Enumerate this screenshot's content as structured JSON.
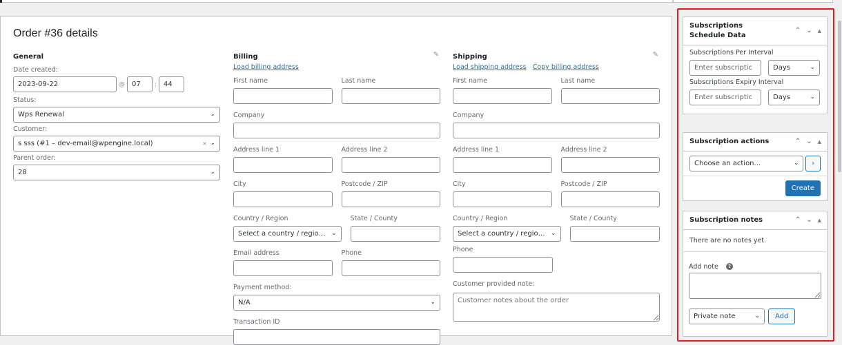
{
  "order": {
    "title": "Order #36 details",
    "general": {
      "heading": "General",
      "date_label": "Date created:",
      "date_value": "2023-09-22",
      "at_sign": "@",
      "hour": "07",
      "colon": ":",
      "minute": "44",
      "status_label": "Status:",
      "status_value": "Wps Renewal",
      "customer_label": "Customer:",
      "customer_value": "s sss (#1 – dev-email@wpengine.local)",
      "customer_clear": "×",
      "parent_label": "Parent order:",
      "parent_value": "28"
    },
    "billing": {
      "heading": "Billing",
      "load_link": "Load billing address",
      "first_name": "First name",
      "last_name": "Last name",
      "company": "Company",
      "address1": "Address line 1",
      "address2": "Address line 2",
      "city": "City",
      "postcode": "Postcode / ZIP",
      "country": "Country / Region",
      "country_placeholder": "Select a country / regio…",
      "state": "State / County",
      "email": "Email address",
      "phone": "Phone",
      "payment_label": "Payment method:",
      "payment_value": "N/A",
      "transaction_label": "Transaction ID"
    },
    "shipping": {
      "heading": "Shipping",
      "load_link": "Load shipping address",
      "copy_link": "Copy billing address",
      "first_name": "First name",
      "last_name": "Last name",
      "company": "Company",
      "address1": "Address line 1",
      "address2": "Address line 2",
      "city": "City",
      "postcode": "Postcode / ZIP",
      "country": "Country / Region",
      "country_placeholder": "Select a country / regio…",
      "state": "State / County",
      "phone": "Phone",
      "note_label": "Customer provided note:",
      "note_placeholder": "Customer notes about the order"
    }
  },
  "sidebar": {
    "schedule": {
      "title": "Subscriptions Schedule Data",
      "per_interval_label": "Subscriptions Per Interval",
      "per_interval_placeholder": "Enter subscriptic",
      "per_interval_unit": "Days",
      "expiry_label": "Subscriptions Expiry Interval",
      "expiry_placeholder": "Enter subscriptic",
      "expiry_unit": "Days"
    },
    "actions": {
      "title": "Subscription actions",
      "select_value": "Choose an action...",
      "go_label": "›",
      "create_label": "Create"
    },
    "notes": {
      "title": "Subscription notes",
      "empty_text": "There are no notes yet.",
      "add_note_label": "Add note",
      "help_glyph": "?",
      "note_type": "Private note",
      "add_button": "Add"
    },
    "controls": {
      "up": "⌃",
      "down": "⌄",
      "toggle": "▲"
    }
  },
  "icons": {
    "edit": "✎",
    "chevron": "⌄"
  },
  "colors": {
    "accent": "#2271b1",
    "highlight": "#e11c1c"
  }
}
